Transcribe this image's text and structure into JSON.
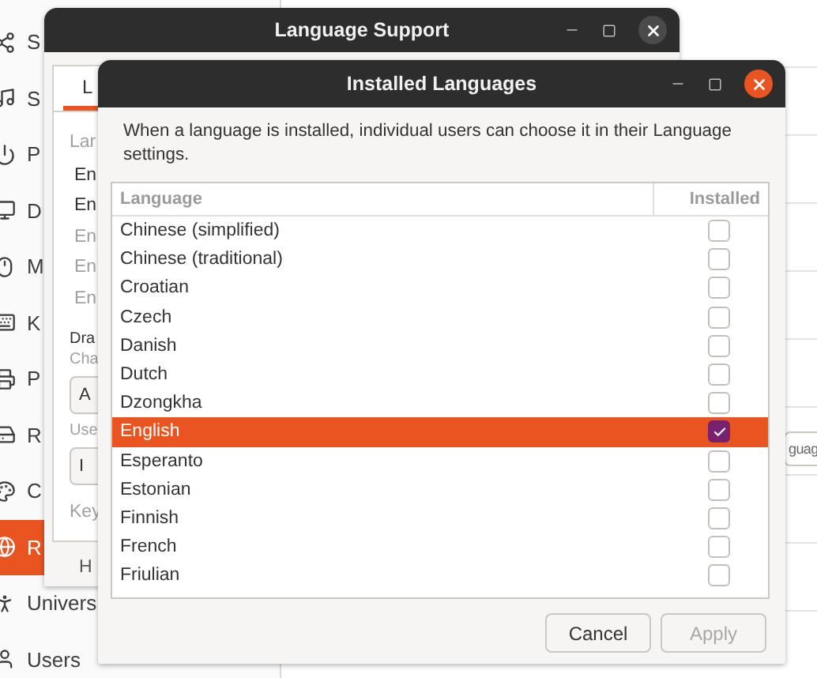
{
  "settings": {
    "sidebar": [
      {
        "label": "S",
        "selected": false
      },
      {
        "label": "S",
        "selected": false
      },
      {
        "label": "P",
        "selected": false
      },
      {
        "label": "D",
        "selected": false
      },
      {
        "label": "M",
        "selected": false
      },
      {
        "label": "K",
        "selected": false
      },
      {
        "label": "P",
        "selected": false
      },
      {
        "label": "R",
        "selected": false
      },
      {
        "label": "C",
        "selected": false
      },
      {
        "label": "R",
        "selected": true
      },
      {
        "label": "Univers",
        "selected": false
      },
      {
        "label": "Users",
        "selected": false
      }
    ],
    "language_field": {
      "value": "guag"
    }
  },
  "language_support": {
    "title": "Language Support",
    "tabs": [
      {
        "label": "L",
        "selected": true
      }
    ],
    "content": [
      {
        "kind": "heading",
        "text": "Lar"
      },
      {
        "kind": "item",
        "text": "En",
        "disabled": false
      },
      {
        "kind": "item",
        "text": "En",
        "disabled": false
      },
      {
        "kind": "item",
        "text": "En",
        "disabled": true
      },
      {
        "kind": "item",
        "text": "En",
        "disabled": true
      },
      {
        "kind": "item",
        "text": "En",
        "disabled": true
      },
      {
        "kind": "label",
        "text": "Dra"
      },
      {
        "kind": "hint",
        "text": "Cha"
      },
      {
        "kind": "button",
        "text": "A"
      },
      {
        "kind": "hint",
        "text": "Use"
      },
      {
        "kind": "button",
        "text": "I"
      },
      {
        "kind": "heading",
        "text": "Key"
      }
    ],
    "footer": "H"
  },
  "installed_languages": {
    "title": "Installed Languages",
    "description": "When a language is installed, individual users can choose it in their Language settings.",
    "columns": [
      "Language",
      "Installed"
    ],
    "rows": [
      {
        "name": "Chinese (simplified)",
        "installed": false,
        "selected": false
      },
      {
        "name": "Chinese (traditional)",
        "installed": false,
        "selected": false
      },
      {
        "name": "Croatian",
        "installed": false,
        "selected": false
      },
      {
        "name": "Czech",
        "installed": false,
        "selected": false
      },
      {
        "name": "Danish",
        "installed": false,
        "selected": false
      },
      {
        "name": "Dutch",
        "installed": false,
        "selected": false
      },
      {
        "name": "Dzongkha",
        "installed": false,
        "selected": false
      },
      {
        "name": "English",
        "installed": true,
        "selected": true
      },
      {
        "name": "Esperanto",
        "installed": false,
        "selected": false
      },
      {
        "name": "Estonian",
        "installed": false,
        "selected": false
      },
      {
        "name": "Finnish",
        "installed": false,
        "selected": false
      },
      {
        "name": "French",
        "installed": false,
        "selected": false
      },
      {
        "name": "Friulian",
        "installed": false,
        "selected": false
      }
    ],
    "buttons": [
      {
        "label": "Cancel",
        "disabled": false
      },
      {
        "label": "Apply",
        "disabled": true
      }
    ]
  }
}
